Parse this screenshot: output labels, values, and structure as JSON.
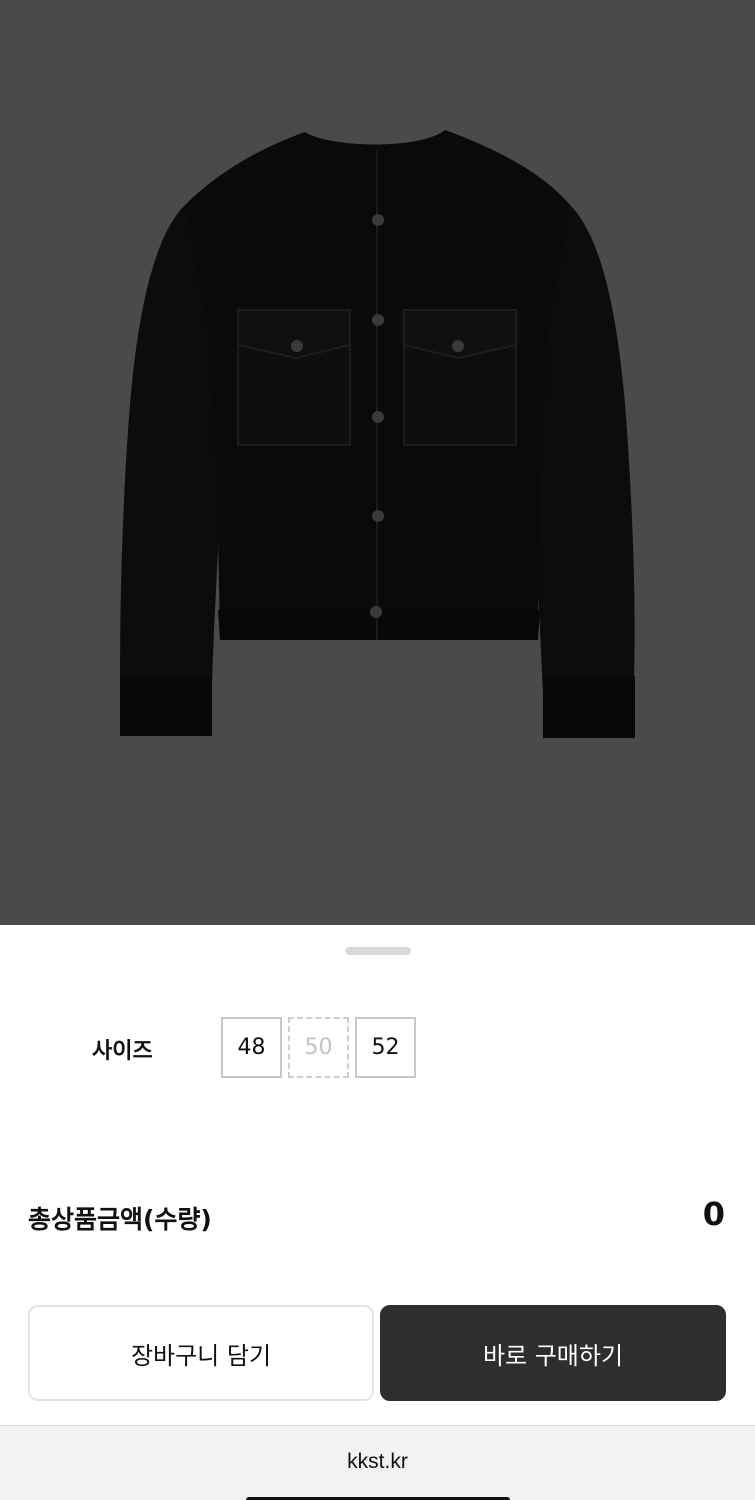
{
  "product": {
    "image_icon": "black-cropped-jacket-image"
  },
  "options": {
    "size_label": "사이즈",
    "sizes": [
      {
        "label": "48",
        "available": true
      },
      {
        "label": "50",
        "available": false
      },
      {
        "label": "52",
        "available": true
      }
    ]
  },
  "summary": {
    "total_label": "총상품금액(수량)",
    "total_value": "0"
  },
  "actions": {
    "cart_label": "장바구니 담기",
    "buy_label": "바로 구매하기"
  },
  "browser": {
    "url": "kkst.kr"
  },
  "colors": {
    "backdrop": "#4a4a4a",
    "buy_button": "#2e2e2e",
    "sheet": "#ffffff"
  }
}
